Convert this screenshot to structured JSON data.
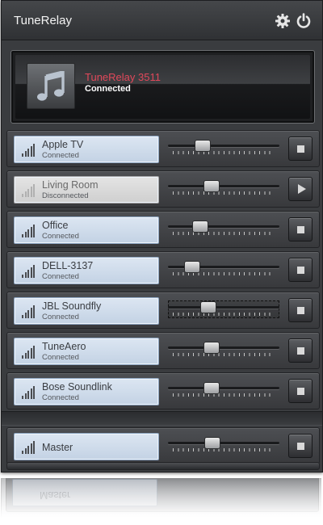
{
  "app": {
    "title": "TuneRelay",
    "toolbar": {
      "settings_icon": "gear-icon",
      "power_icon": "power-icon"
    }
  },
  "now_playing": {
    "name": "TuneRelay 3511",
    "status": "Connected",
    "artwork_icon": "music-note-icon",
    "name_color": "#e0485a"
  },
  "devices": [
    {
      "name": "Apple TV",
      "status": "Connected",
      "volume": 0.28,
      "action": "stop",
      "enabled": true,
      "signal_bars": 5
    },
    {
      "name": "Living Room",
      "status": "Disconnected",
      "volume": 0.37,
      "action": "play",
      "enabled": false,
      "signal_bars": 5
    },
    {
      "name": "Office",
      "status": "Connected",
      "volume": 0.25,
      "action": "stop",
      "enabled": true,
      "signal_bars": 5
    },
    {
      "name": "DELL-3137",
      "status": "Connected",
      "volume": 0.17,
      "action": "stop",
      "enabled": true,
      "signal_bars": 5
    },
    {
      "name": "JBL Soundfly",
      "status": "Connected",
      "volume": 0.34,
      "action": "stop",
      "enabled": true,
      "signal_bars": 5,
      "focused": true
    },
    {
      "name": "TuneAero",
      "status": "Connected",
      "volume": 0.37,
      "action": "stop",
      "enabled": true,
      "signal_bars": 5
    },
    {
      "name": "Bose Soundlink",
      "status": "Connected",
      "volume": 0.37,
      "action": "stop",
      "enabled": true,
      "signal_bars": 5
    }
  ],
  "master": {
    "name": "Master",
    "volume": 0.38,
    "action": "stop"
  },
  "colors": {
    "accent": "#e0485a",
    "label_bg": "#c3d2e4",
    "window_bg": "#3a3c3f"
  }
}
